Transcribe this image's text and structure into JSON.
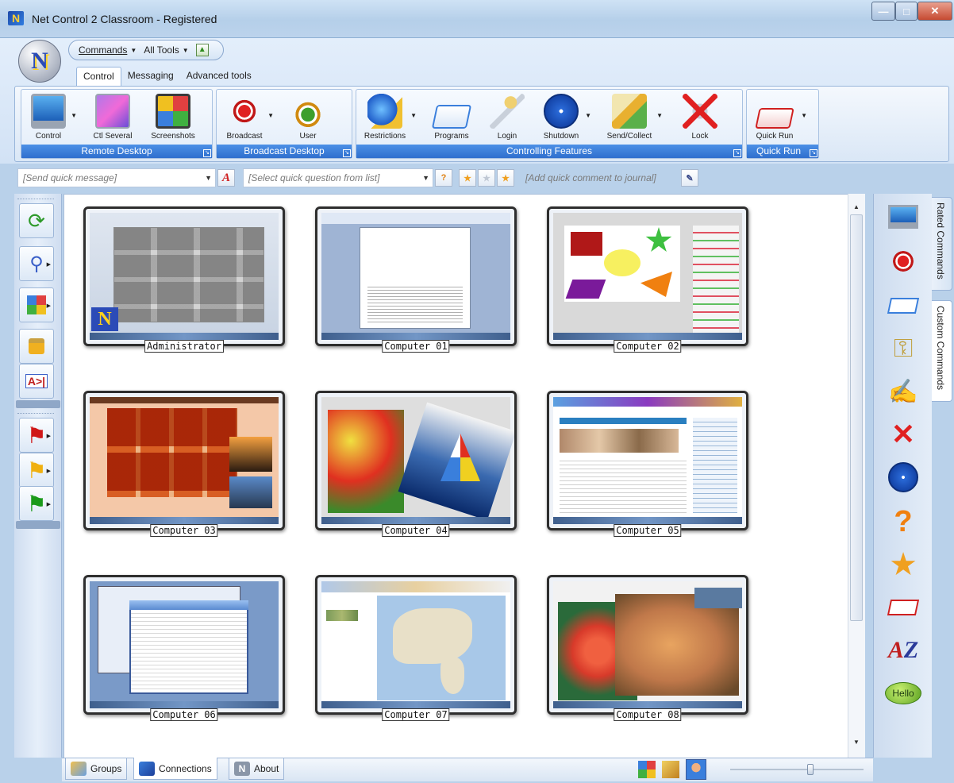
{
  "window": {
    "title": "Net Control 2 Classroom - Registered"
  },
  "qat": {
    "commands": "Commands",
    "all_tools": "All Tools"
  },
  "tabs": [
    {
      "label": "Control",
      "active": true
    },
    {
      "label": "Messaging",
      "active": false
    },
    {
      "label": "Advanced tools",
      "active": false
    }
  ],
  "ribbon": {
    "groups": [
      "Remote Desktop",
      "Broadcast Desktop",
      "Controlling Features",
      "Quick Run"
    ],
    "buttons": {
      "control": "Control",
      "ctl_several": "Ctl Several",
      "screenshots": "Screenshots",
      "broadcast": "Broadcast",
      "user": "User",
      "restrictions": "Restrictions",
      "programs": "Programs",
      "login": "Login",
      "shutdown": "Shutdown",
      "send_collect": "Send/Collect",
      "lock": "Lock",
      "quick_run": "Quick Run"
    }
  },
  "message_bar": {
    "quick_message": "[Send quick message]",
    "quick_question": "[Select quick question from list]",
    "journal": "[Add quick comment to journal]"
  },
  "computers": [
    {
      "name": "Administrator",
      "screen": "admin"
    },
    {
      "name": "Computer 01",
      "screen": "doc"
    },
    {
      "name": "Computer 02",
      "screen": "shapes"
    },
    {
      "name": "Computer 03",
      "screen": "photos"
    },
    {
      "name": "Computer 04",
      "screen": "sailboat"
    },
    {
      "name": "Computer 05",
      "screen": "news"
    },
    {
      "name": "Computer 06",
      "screen": "explorer"
    },
    {
      "name": "Computer 07",
      "screen": "map"
    },
    {
      "name": "Computer 08",
      "screen": "cat"
    }
  ],
  "side_tabs": {
    "rated": "Rated Commands",
    "custom": "Custom Commands"
  },
  "right_icons": [
    "monitor-icon",
    "broadcast-icon",
    "programs-icon",
    "keys-icon",
    "journal-icon",
    "lock-icon",
    "shutdown-icon",
    "question-icon",
    "star-icon",
    "quick-run-icon",
    "az-icon",
    "hello-icon"
  ],
  "hello_text": "Hello",
  "bottom_tabs": [
    {
      "label": "Groups",
      "active": false
    },
    {
      "label": "Connections",
      "active": true
    },
    {
      "label": "About",
      "active": false
    }
  ],
  "zoom_level": 0.6,
  "colors": {
    "accent": "#3a7fdc",
    "ribbon_label": "#2f6fce",
    "window": "#b9d1ea"
  }
}
